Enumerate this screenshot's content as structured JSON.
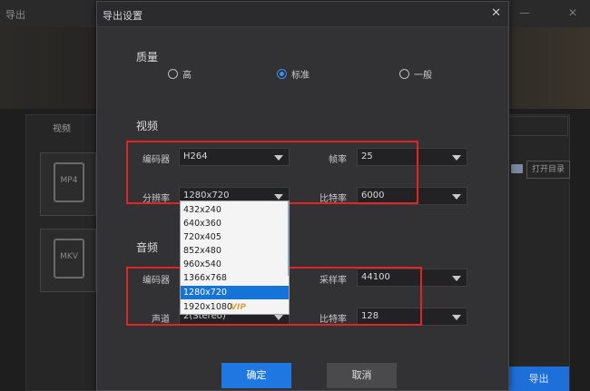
{
  "background": {
    "app_title": "导出",
    "tab_video": "视频",
    "formats": [
      "MP4",
      "MKV"
    ],
    "open_folder_label": "打开目录",
    "export_button": "导出"
  },
  "dialog": {
    "title": "导出设置",
    "close": "✕",
    "quality": {
      "heading": "质量",
      "options": [
        "高",
        "标准",
        "一般"
      ],
      "selected": "标准"
    },
    "video": {
      "heading": "视频",
      "codec_label": "编码器",
      "codec_value": "H264",
      "framerate_label": "帧率",
      "framerate_value": "25",
      "resolution_label": "分辨率",
      "resolution_value": "1280x720",
      "bitrate_label": "比特率",
      "bitrate_value": "6000"
    },
    "audio": {
      "heading": "音频",
      "codec_label": "编码器",
      "samplerate_label": "采样率",
      "samplerate_value": "44100",
      "channel_label": "声道",
      "channel_value": "2(Stereo)",
      "bitrate_label": "比特率",
      "bitrate_value": "128"
    },
    "resolution_dropdown": {
      "options": [
        "432x240",
        "640x360",
        "720x405",
        "852x480",
        "960x540",
        "1366x768",
        "1280x720",
        "1920x1080"
      ],
      "selected": "1280x720",
      "vip_badge": "VIP"
    },
    "ok_button": "确定",
    "cancel_button": "取消"
  },
  "colors": {
    "accent": "#1f78e2",
    "highlight": "#e02525"
  }
}
